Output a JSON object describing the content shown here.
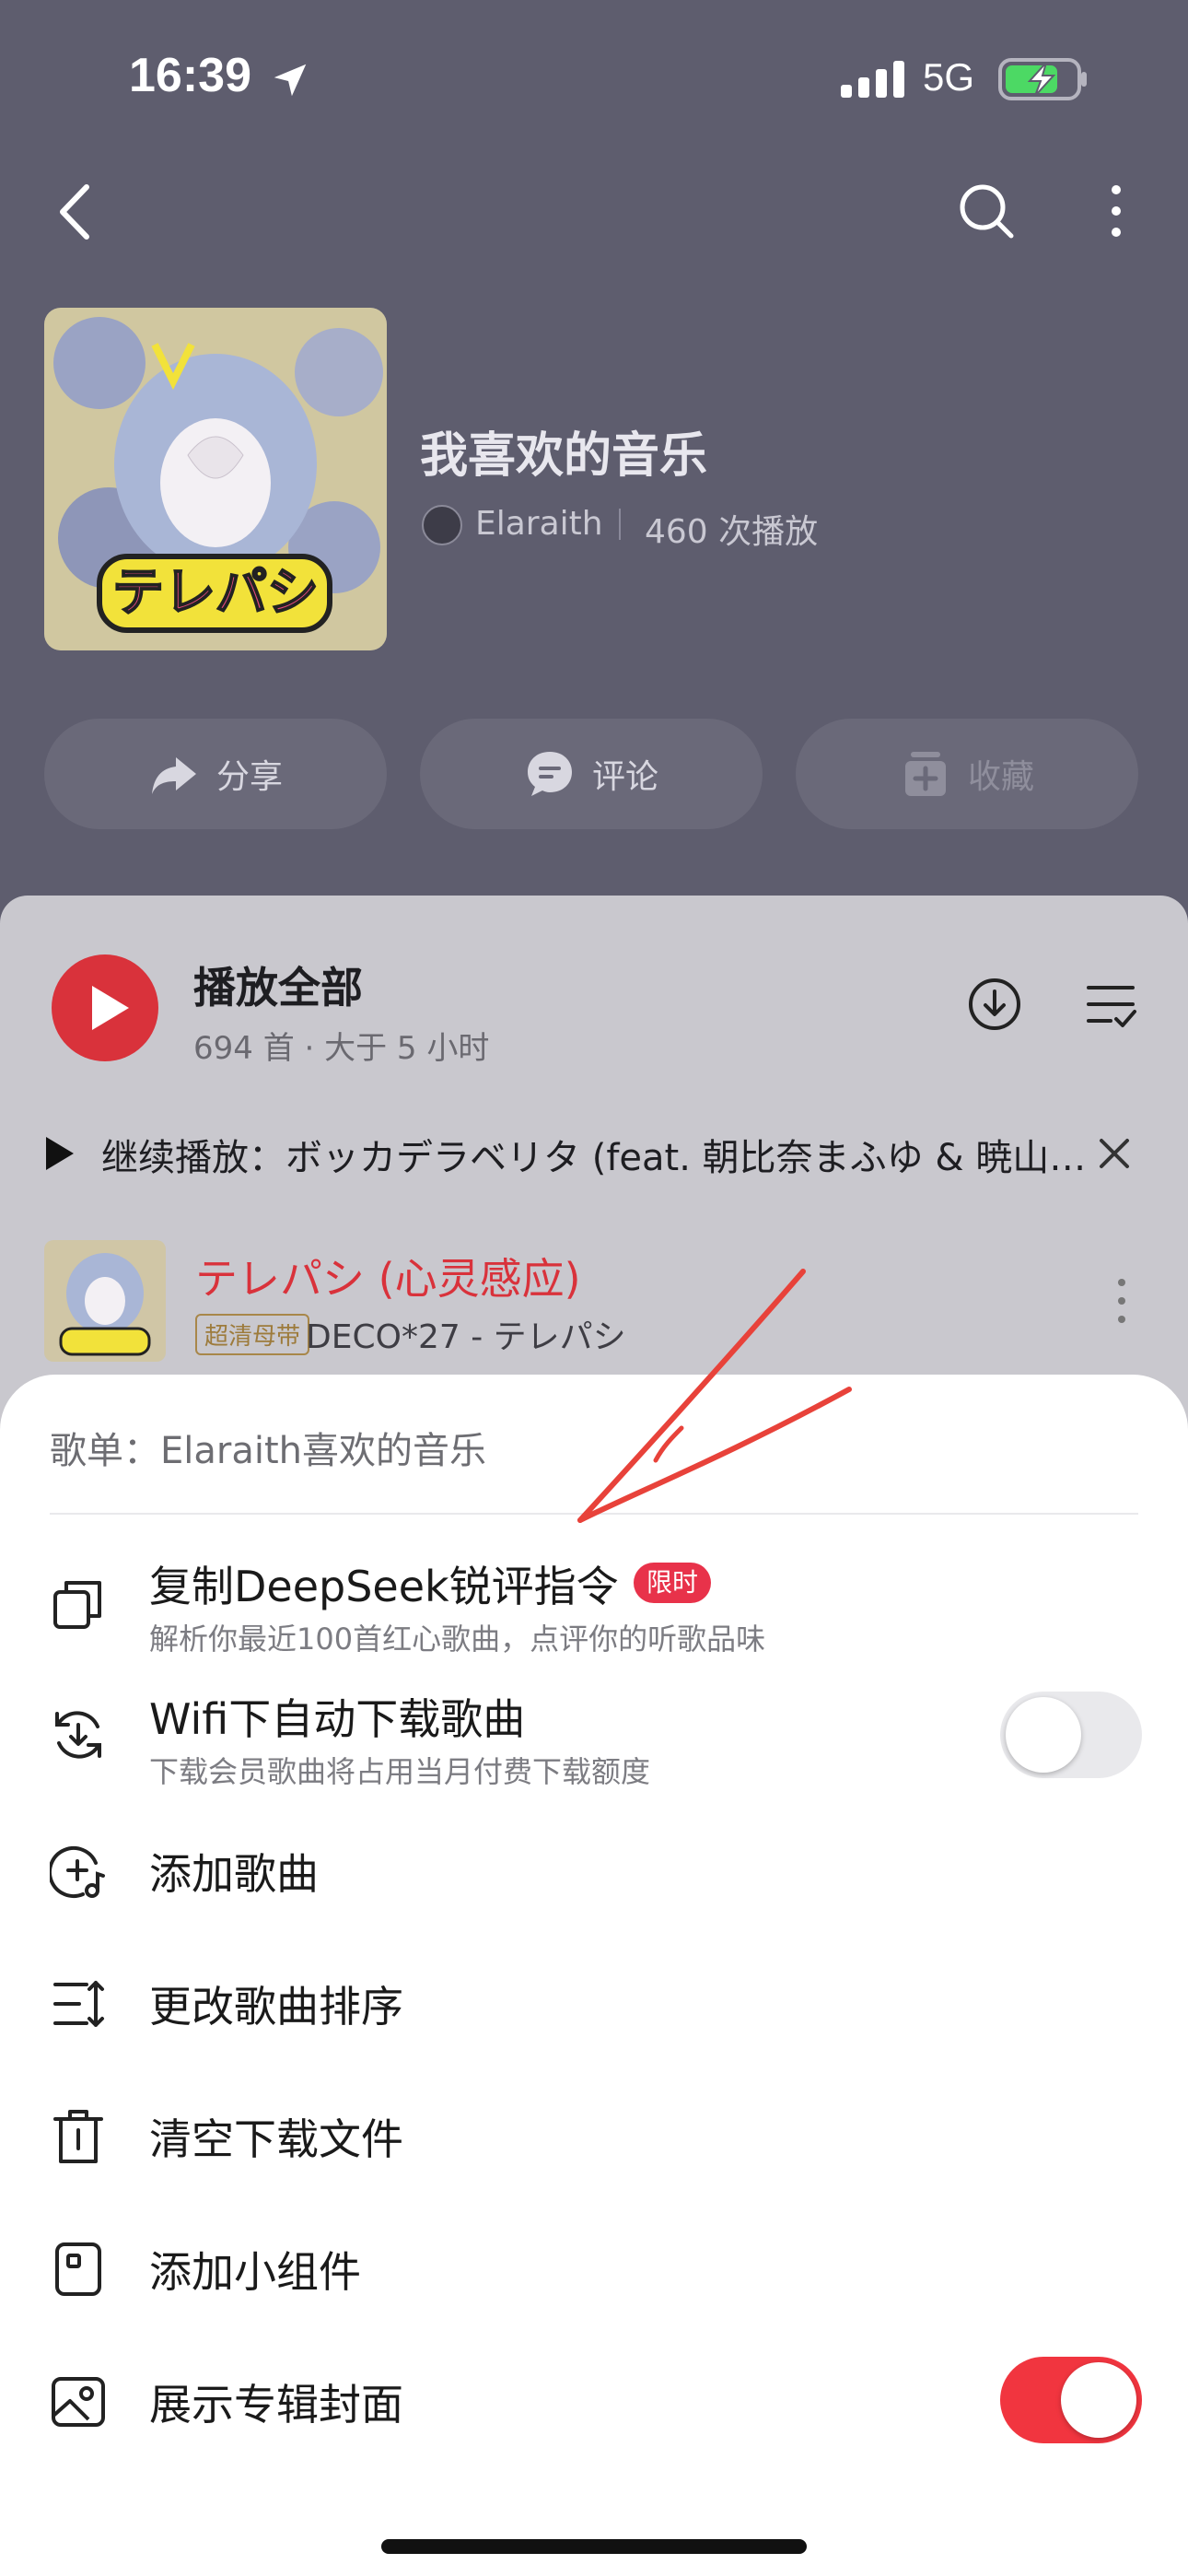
{
  "status_bar": {
    "time": "16:39",
    "network": "5G"
  },
  "playlist": {
    "title": "我喜欢的音乐",
    "owner": "Elaraith",
    "plays": "460 次播放"
  },
  "actions": {
    "share": "分享",
    "comment": "评论",
    "collect": "收藏"
  },
  "play_all": {
    "label": "播放全部",
    "meta": "694 首 · 大于 5 小时"
  },
  "continue_play": {
    "text": "继续播放：ボッカデラベリタ (feat. 朝比奈まふゆ & 暁山瑞希)"
  },
  "current_song": {
    "title": "テレパシ (心灵感应)",
    "badge": "超清母带",
    "artist": "DECO*27 - テレパシ"
  },
  "sheet": {
    "header": "歌单：Elaraith喜欢的音乐",
    "items": [
      {
        "label": "复制DeepSeek锐评指令",
        "sub": "解析你最近100首红心歌曲，点评你的听歌品味",
        "badge": "限时"
      },
      {
        "label": "Wifi下自动下载歌曲",
        "sub": "下载会员歌曲将占用当月付费下载额度",
        "toggle": false
      },
      {
        "label": "添加歌曲"
      },
      {
        "label": "更改歌曲排序"
      },
      {
        "label": "清空下载文件"
      },
      {
        "label": "添加小组件"
      },
      {
        "label": "展示专辑封面",
        "toggle": true
      }
    ]
  },
  "colors": {
    "accent_red": "#d9323b",
    "toggle_on": "#f1353f",
    "header_bg": "#5e5d6e",
    "list_bg": "#c9c8ce",
    "annotation": "#e8423a"
  }
}
